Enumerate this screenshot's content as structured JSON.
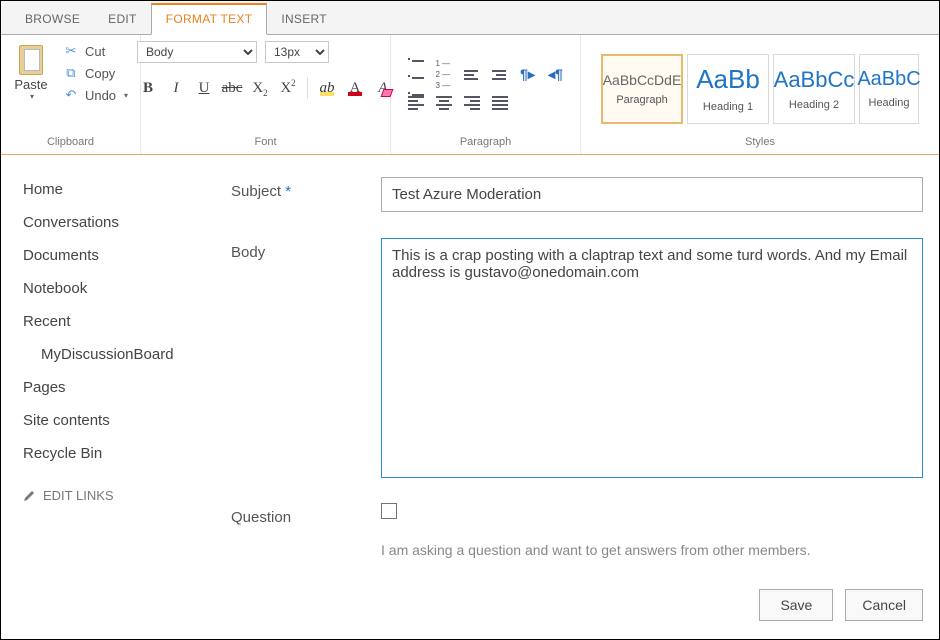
{
  "tabs": {
    "browse": "BROWSE",
    "edit": "EDIT",
    "format_text": "FORMAT TEXT",
    "insert": "INSERT"
  },
  "ribbon": {
    "clipboard": {
      "label": "Clipboard",
      "paste": "Paste",
      "cut": "Cut",
      "copy": "Copy",
      "undo": "Undo"
    },
    "font": {
      "label": "Font",
      "font_name": "Body",
      "font_size": "13px"
    },
    "paragraph": {
      "label": "Paragraph"
    },
    "styles": {
      "label": "Styles",
      "items": [
        {
          "sample": "AaBbCcDdE",
          "label": "Paragraph",
          "kind": "para",
          "selected": true
        },
        {
          "sample": "AaBb",
          "label": "Heading 1",
          "kind": "h"
        },
        {
          "sample": "AaBbCc",
          "label": "Heading 2",
          "kind": "h"
        },
        {
          "sample": "AaBbC",
          "label": "Heading",
          "kind": "h"
        }
      ]
    }
  },
  "nav": {
    "items": [
      "Home",
      "Conversations",
      "Documents",
      "Notebook",
      "Recent",
      "MyDiscussionBoard",
      "Pages",
      "Site contents",
      "Recycle Bin"
    ],
    "edit_links": "EDIT LINKS"
  },
  "form": {
    "subject_label": "Subject",
    "subject_value": "Test Azure Moderation",
    "body_label": "Body",
    "body_value": "This is a crap posting with a claptrap text and some turd words. And my Email address is gustavo@onedomain.com",
    "question_label": "Question",
    "question_help": "I am asking a question and want to get answers from other members.",
    "save": "Save",
    "cancel": "Cancel"
  }
}
